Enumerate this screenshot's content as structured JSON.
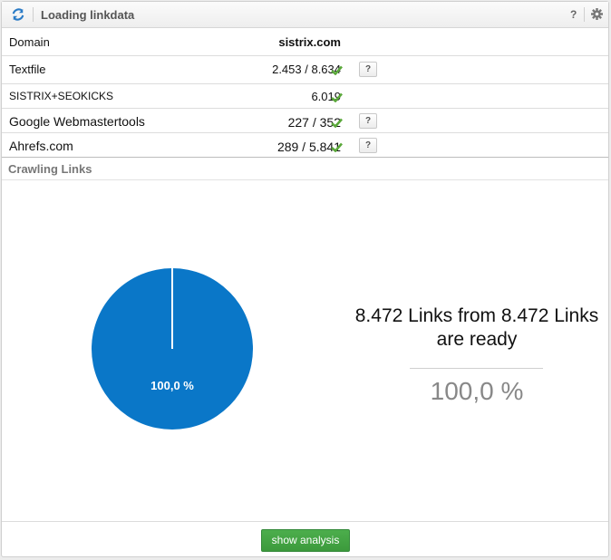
{
  "header": {
    "title": "Loading linkdata",
    "help_label": "?"
  },
  "table": {
    "header": {
      "label": "Domain",
      "value": "sistrix.com"
    },
    "rows": [
      {
        "label": "Textfile",
        "value": "2.453 / 8.634",
        "status": "check",
        "help": "?"
      },
      {
        "label": "SISTRIX+SEOKICKS",
        "value": "6.019",
        "status": "check"
      },
      {
        "label": "Google Webmastertools",
        "value": "227 / 352",
        "status": "check",
        "help": "?"
      },
      {
        "label": "Ahrefs.com",
        "value": "289 / 5.841",
        "status": "check",
        "help": "?"
      }
    ]
  },
  "crawling": {
    "section_title": "Crawling Links",
    "pie_label": "100,0 %",
    "progress_fraction": 1.0,
    "summary_line1": "8.472 Links from 8.472 Links",
    "summary_line2": "are ready",
    "summary_percent": "100,0 %"
  },
  "footer": {
    "button_label": "show analysis"
  },
  "colors": {
    "pie_fill": "#0a77c8",
    "check": "#5aa83a",
    "button": "#43a543"
  },
  "icons": [
    "refresh-icon",
    "help-icon",
    "gear-icon",
    "checkmark-icon"
  ]
}
